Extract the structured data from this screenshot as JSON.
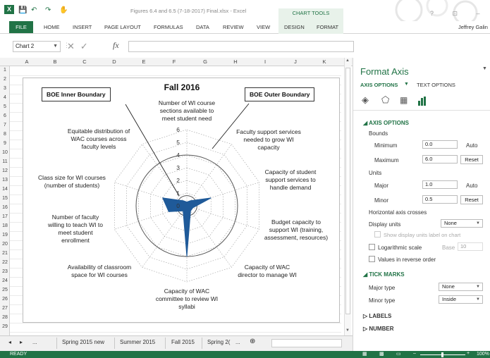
{
  "window": {
    "title": "Figures 6.4 and 6.5 (7-18-2017) Final.xlsx - Excel",
    "app_logo": "X",
    "context_tab_group": "CHART TOOLS",
    "user": "Jeffrey Galin",
    "window_buttons": "? ⊡ –"
  },
  "quick_access": {
    "save_icon": "save-icon",
    "undo_icon": "undo-icon",
    "redo_icon": "redo-icon",
    "touch_icon": "touch-mode-icon"
  },
  "ribbon": {
    "file": "FILE",
    "tabs": [
      "HOME",
      "INSERT",
      "PAGE LAYOUT",
      "FORMULAS",
      "DATA",
      "REVIEW",
      "VIEW",
      "DESIGN",
      "FORMAT"
    ]
  },
  "formula_bar": {
    "name_box": "Chart 2",
    "fx": "fx",
    "value": ""
  },
  "grid": {
    "columns": [
      "A",
      "B",
      "C",
      "D",
      "E",
      "F",
      "G",
      "H",
      "I",
      "J",
      "K"
    ],
    "rows": [
      "1",
      "2",
      "3",
      "4",
      "5",
      "6",
      "7",
      "8",
      "9",
      "10",
      "11",
      "12",
      "13",
      "14",
      "15",
      "16",
      "17",
      "18",
      "19",
      "20",
      "21",
      "22",
      "23",
      "24",
      "25",
      "26",
      "27",
      "28",
      "29"
    ]
  },
  "chart": {
    "title": "Fall 2016",
    "inner_boundary_label": "BOE Inner Boundary",
    "outer_boundary_label": "BOE Outer Boundary"
  },
  "chart_data": {
    "type": "radar",
    "title": "Fall 2016",
    "categories": [
      "Number of WI course sections available to meet student need",
      "Faculty support services needed to grow WI capacity",
      "Capacity of student support services to handle demand",
      "Budget capacity to support WI (training, assessment, resources)",
      "Capacity of WAC director to manage WI",
      "Capacity of WAC committee to review WI syllabi",
      "Availability of classroom space for WI courses",
      "Number of faculty willing to teach WI to meet student enrollment",
      "Class size for WI courses (number of students)",
      "Equitable distribution of WAC courses across faculty levels"
    ],
    "category_lines": [
      [
        "Number of WI course",
        "sections available to",
        "meet student need"
      ],
      [
        "Faculty support services",
        "needed to grow WI",
        "capacity"
      ],
      [
        "Capacity of student",
        "support services to",
        "handle demand"
      ],
      [
        "Budget capacity to",
        "support WI (training,",
        "assessment, resources)"
      ],
      [
        "Capacity of WAC",
        "director to manage WI"
      ],
      [
        "Capacity of WAC",
        "committee to review WI",
        "syllabi"
      ],
      [
        "Availability of classroom",
        "space for WI courses"
      ],
      [
        "Number of faculty",
        "willing to teach WI to",
        "meet student",
        "enrollment"
      ],
      [
        "Class size for WI courses",
        "(number of students)"
      ],
      [
        "Equitable distribution of",
        "WAC courses across",
        "faculty levels"
      ]
    ],
    "series": [
      {
        "values": [
          0.3,
          0.5,
          2.0,
          0.5,
          0.5,
          4.0,
          0.5,
          1.5,
          2.0,
          0.5
        ],
        "color": "#1f5a99"
      }
    ],
    "boundaries": {
      "inner": 0.8,
      "outer": 4.0
    },
    "axis_ticks": [
      "0",
      "1",
      "2",
      "3",
      "4",
      "5",
      "6"
    ],
    "ylim": [
      0,
      6
    ],
    "major_unit": 1,
    "grid": true
  },
  "sheets": {
    "nav_prev": "◂",
    "nav_next": "▸",
    "more": "...",
    "tabs": [
      "Spring 2015 new",
      "Summer 2015",
      "Fall 2015",
      "Spring 2("
    ],
    "more_right": "...",
    "add": "⊕"
  },
  "status": {
    "ready": "READY",
    "zoom": "100%"
  },
  "panel": {
    "title": "Format Axis",
    "tab_axis": "AXIS OPTIONS",
    "tab_text": "TEXT OPTIONS",
    "section_axis_options": "AXIS OPTIONS",
    "bounds": "Bounds",
    "minimum_label": "Minimum",
    "minimum_value": "0.0",
    "minimum_btn": "Auto",
    "maximum_label": "Maximum",
    "maximum_value": "6.0",
    "maximum_btn": "Reset",
    "units": "Units",
    "major_label": "Major",
    "major_value": "1.0",
    "major_btn": "Auto",
    "minor_label": "Minor",
    "minor_value": "0.5",
    "minor_btn": "Reset",
    "h_axis_crosses": "Horizontal axis crosses",
    "display_units_label": "Display units",
    "display_units_value": "None",
    "show_units_label": "Show display units label on chart",
    "log_scale": "Logarithmic scale",
    "base_label": "Base",
    "base_value": "10",
    "reverse": "Values in reverse order",
    "section_tick": "TICK MARKS",
    "major_type_label": "Major type",
    "major_type_value": "None",
    "minor_type_label": "Minor type",
    "minor_type_value": "Inside",
    "section_labels": "LABELS",
    "section_number": "NUMBER"
  }
}
